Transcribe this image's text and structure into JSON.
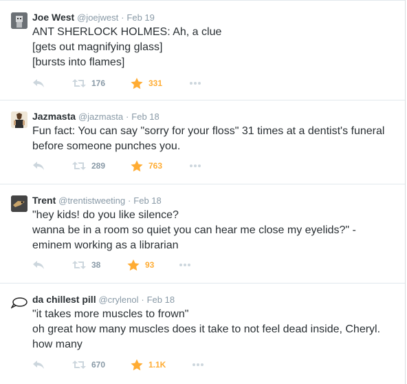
{
  "colors": {
    "name": "#292f33",
    "meta": "#8899a6",
    "icon": "#ccd6dd",
    "favorite": "#ffac33",
    "divider": "#e1e8ed"
  },
  "tweets": [
    {
      "avatar_icon": "robot-avatar",
      "name": "Joe West",
      "handle": "@joejwest",
      "separator": "·",
      "time": "Feb 19",
      "lines": [
        "ANT SHERLOCK HOLMES: Ah, a clue",
        "[gets out magnifying glass]",
        "[bursts into flames]"
      ],
      "retweets": "176",
      "favorites": "331"
    },
    {
      "avatar_icon": "horse-person-avatar",
      "name": "Jazmasta",
      "handle": "@jazmasta",
      "separator": "·",
      "time": "Feb 18",
      "lines": [
        "Fun fact: You can say \"sorry for your floss\" 31 times at a dentist's funeral",
        "before someone punches you."
      ],
      "retweets": "289",
      "favorites": "763"
    },
    {
      "avatar_icon": "bird-avatar",
      "name": "Trent",
      "handle": "@trentistweeting",
      "separator": "·",
      "time": "Feb 18",
      "lines": [
        "\"hey kids! do you like silence?",
        "wanna be in a room so quiet you can hear me close my eyelids?\" -",
        "eminem working as a librarian"
      ],
      "retweets": "38",
      "favorites": "93"
    },
    {
      "avatar_icon": "speech-bubble-avatar",
      "name": "da chillest pill",
      "handle": "@crylenol",
      "separator": "·",
      "time": "Feb 18",
      "lines": [
        "\"it takes more muscles to frown\"",
        "oh great how many muscles does it take to not feel dead inside, Cheryl.",
        "how many"
      ],
      "retweets": "670",
      "favorites": "1.1K"
    }
  ]
}
